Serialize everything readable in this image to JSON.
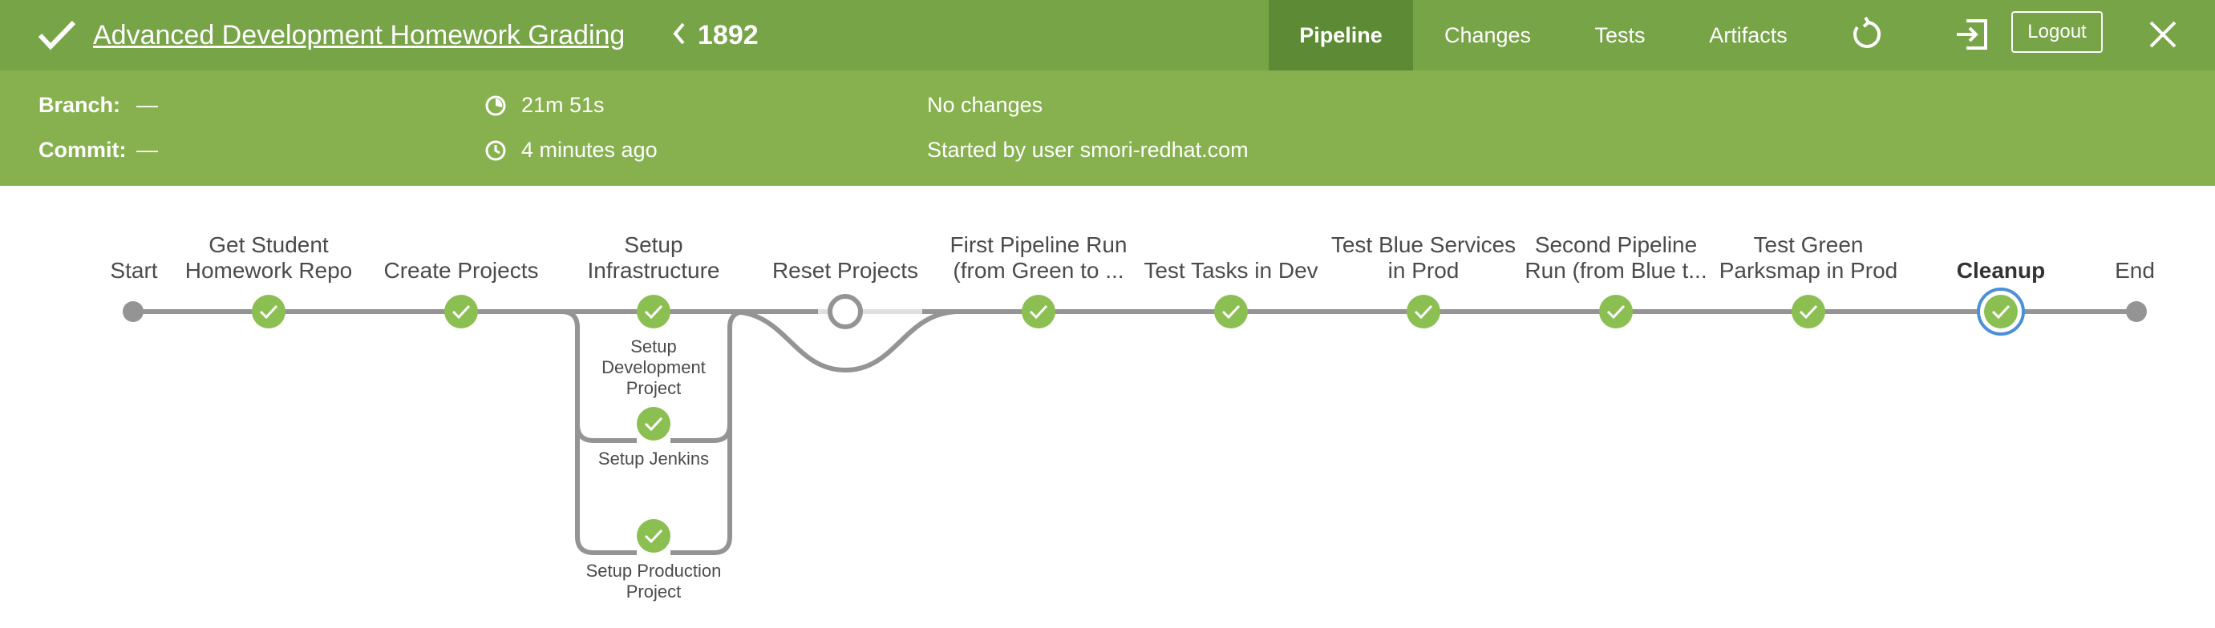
{
  "header": {
    "title": "Advanced Development Homework Grading",
    "run_number": "1892",
    "nav": [
      "Pipeline",
      "Changes",
      "Tests",
      "Artifacts"
    ],
    "logout_label": "Logout",
    "icons": [
      "check-icon",
      "chevron-left-icon",
      "rerun-icon",
      "exit-icon",
      "close-icon"
    ],
    "colors": {
      "header_bg": "#77a447",
      "info_bg": "#87b14e",
      "active_tab": "#5d8b35"
    }
  },
  "info": {
    "branch_label": "Branch:",
    "branch_value": "—",
    "commit_label": "Commit:",
    "commit_value": "—",
    "duration": "21m 51s",
    "started": "4 minutes ago",
    "changes": "No changes",
    "started_by": "Started by user smori-redhat.com"
  },
  "pipeline": {
    "stages": [
      {
        "label1": "Start",
        "label2": ""
      },
      {
        "label1": "Get Student",
        "label2": "Homework Repo"
      },
      {
        "label1": "Create Projects",
        "label2": ""
      },
      {
        "label1": "Setup",
        "label2": "Infrastructure"
      },
      {
        "label1": "Reset Projects",
        "label2": ""
      },
      {
        "label1": "First Pipeline Run",
        "label2": "(from Green to ..."
      },
      {
        "label1": "Test Tasks in Dev",
        "label2": ""
      },
      {
        "label1": "Test Blue Services",
        "label2": "in Prod"
      },
      {
        "label1": "Second Pipeline",
        "label2": "Run (from Blue t..."
      },
      {
        "label1": "Test Green",
        "label2": "Parksmap in Prod"
      },
      {
        "label1": "Cleanup",
        "label2": ""
      },
      {
        "label1": "End",
        "label2": ""
      }
    ],
    "parallel": [
      {
        "lines": [
          "Setup",
          "Development",
          "Project"
        ]
      },
      {
        "lines": [
          "Setup Jenkins"
        ]
      },
      {
        "lines": [
          "Setup Production",
          "Project"
        ]
      }
    ],
    "colors": {
      "success": "#8cbf52",
      "line": "#949494",
      "selected_ring": "#4a90d9",
      "skipped": "#e0e0e0"
    }
  }
}
